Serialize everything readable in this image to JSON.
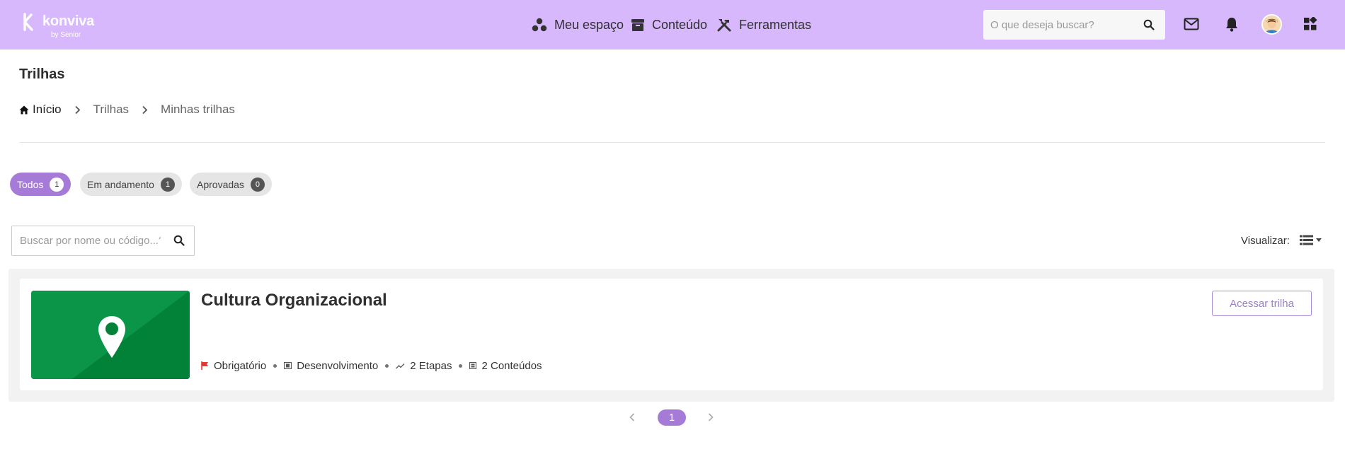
{
  "brand": {
    "name": "konviva",
    "tagline": "by Senior",
    "topbar_color": "#d8b8fc",
    "accent_color": "#a67bd8"
  },
  "nav": {
    "items": [
      {
        "label": "Meu espaço",
        "icon": "people-dots-icon"
      },
      {
        "label": "Conteúdo",
        "icon": "archive-box-icon"
      },
      {
        "label": "Ferramentas",
        "icon": "tools-icon"
      }
    ]
  },
  "top_search": {
    "placeholder": "O que deseja buscar?"
  },
  "top_icons": [
    "mail-icon",
    "bell-icon",
    "avatar",
    "apps-grid-icon"
  ],
  "page": {
    "title": "Trilhas",
    "breadcrumb": [
      "Início",
      "Trilhas",
      "Minhas trilhas"
    ]
  },
  "filters": [
    {
      "label": "Todos",
      "count": "1",
      "active": true
    },
    {
      "label": "Em andamento",
      "count": "1",
      "active": false
    },
    {
      "label": "Aprovadas",
      "count": "0",
      "active": false
    }
  ],
  "list_search": {
    "placeholder": "Buscar por nome ou código...?"
  },
  "view": {
    "label": "Visualizar:",
    "mode_icon": "list-view-icon"
  },
  "results": [
    {
      "title": "Cultura Organizacional",
      "thumbnail_icon": "map-pin-icon",
      "thumbnail_color": "#0a9548",
      "meta": [
        {
          "icon": "flag-icon",
          "text": "Obrigatório",
          "icon_color": "#e53935"
        },
        {
          "icon": "book-icon",
          "text": "Desenvolvimento"
        },
        {
          "icon": "trending-icon",
          "text": "2 Etapas"
        },
        {
          "icon": "content-icon",
          "text": "2 Conteúdos"
        }
      ],
      "action_label": "Acessar trilha"
    }
  ],
  "pagination": {
    "current": "1"
  }
}
